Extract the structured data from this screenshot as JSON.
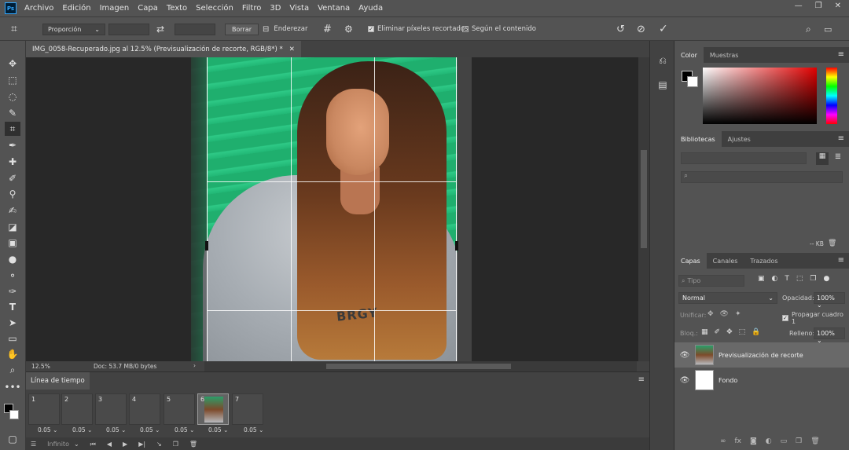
{
  "app": {
    "logo_text": "Ps",
    "menu": [
      "Archivo",
      "Edición",
      "Imagen",
      "Capa",
      "Texto",
      "Selección",
      "Filtro",
      "3D",
      "Vista",
      "Ventana",
      "Ayuda"
    ],
    "window_controls": [
      "—",
      "❐",
      "✕"
    ]
  },
  "options": {
    "ratio_label": "Proporción",
    "clear_label": "Borrar",
    "straighten_label": "Enderezar",
    "delete_cropped_label": "Eliminar píxeles recortados",
    "delete_cropped_checked": true,
    "content_aware_label": "Según el contenido",
    "content_aware_checked": false
  },
  "document": {
    "tab_title": "IMG_0058-Recuperado.jpg al 12.5% (Previsualización de recorte, RGB/8*) *",
    "zoom": "12.5%",
    "doc_info": "Doc: 53.7 MB/0 bytes",
    "photo_text": "BRGY"
  },
  "timeline": {
    "tab_label": "Línea de tiempo",
    "frames": [
      {
        "num": "1",
        "delay": "0.05"
      },
      {
        "num": "2",
        "delay": "0.05"
      },
      {
        "num": "3",
        "delay": "0.05"
      },
      {
        "num": "4",
        "delay": "0.05"
      },
      {
        "num": "5",
        "delay": "0.05"
      },
      {
        "num": "6",
        "delay": "0.05",
        "selected": true
      },
      {
        "num": "7",
        "delay": "0.05"
      }
    ],
    "loop_label": "Infinito"
  },
  "panels": {
    "color_tabs": [
      "Color",
      "Muestras"
    ],
    "library_tabs": [
      "Bibliotecas",
      "Ajustes"
    ],
    "library_size": "-- KB",
    "layers_tabs": [
      "Capas",
      "Canales",
      "Trazados"
    ],
    "search_placeholder": "Tipo",
    "blend_mode": "Normal",
    "opacity_label": "Opacidad:",
    "opacity_value": "100%",
    "unify_label": "Unificar:",
    "propagate_label": "Propagar cuadro 1",
    "lock_label": "Bloq.:",
    "fill_label": "Relleno:",
    "fill_value": "100%",
    "layers": [
      {
        "name": "Previsualización de recorte",
        "selected": true
      },
      {
        "name": "Fondo",
        "selected": false
      }
    ]
  },
  "colors": {
    "accent": "#31a8ff",
    "panel": "#535353",
    "dark": "#282828"
  }
}
